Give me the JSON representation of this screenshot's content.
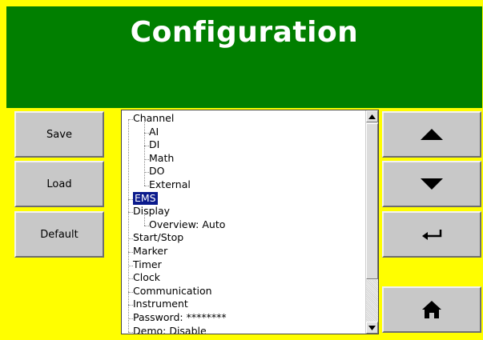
{
  "header": {
    "title": "Configuration"
  },
  "left_buttons": {
    "save": "Save",
    "load": "Load",
    "default": "Default"
  },
  "right_buttons": {
    "up": "up-arrow",
    "down": "down-arrow",
    "enter": "enter-arrow",
    "home": "home-icon"
  },
  "tree": {
    "items": [
      {
        "label": "Channel",
        "level": 0
      },
      {
        "label": "AI",
        "level": 1
      },
      {
        "label": "DI",
        "level": 1
      },
      {
        "label": "Math",
        "level": 1
      },
      {
        "label": "DO",
        "level": 1
      },
      {
        "label": "External",
        "level": 1
      },
      {
        "label": "EMS",
        "level": 0,
        "selected": true
      },
      {
        "label": "Display",
        "level": 0
      },
      {
        "label": "Overview: Auto",
        "level": 1
      },
      {
        "label": "Start/Stop",
        "level": 0
      },
      {
        "label": "Marker",
        "level": 0
      },
      {
        "label": "Timer",
        "level": 0
      },
      {
        "label": "Clock",
        "level": 0
      },
      {
        "label": "Communication",
        "level": 0
      },
      {
        "label": "Instrument",
        "level": 0
      },
      {
        "label": "Password: ********",
        "level": 0
      },
      {
        "label": "Demo: Disable",
        "level": 0
      }
    ]
  },
  "colors": {
    "background": "#fffe00",
    "header": "#017f00",
    "selection": "#0b1a8c"
  }
}
